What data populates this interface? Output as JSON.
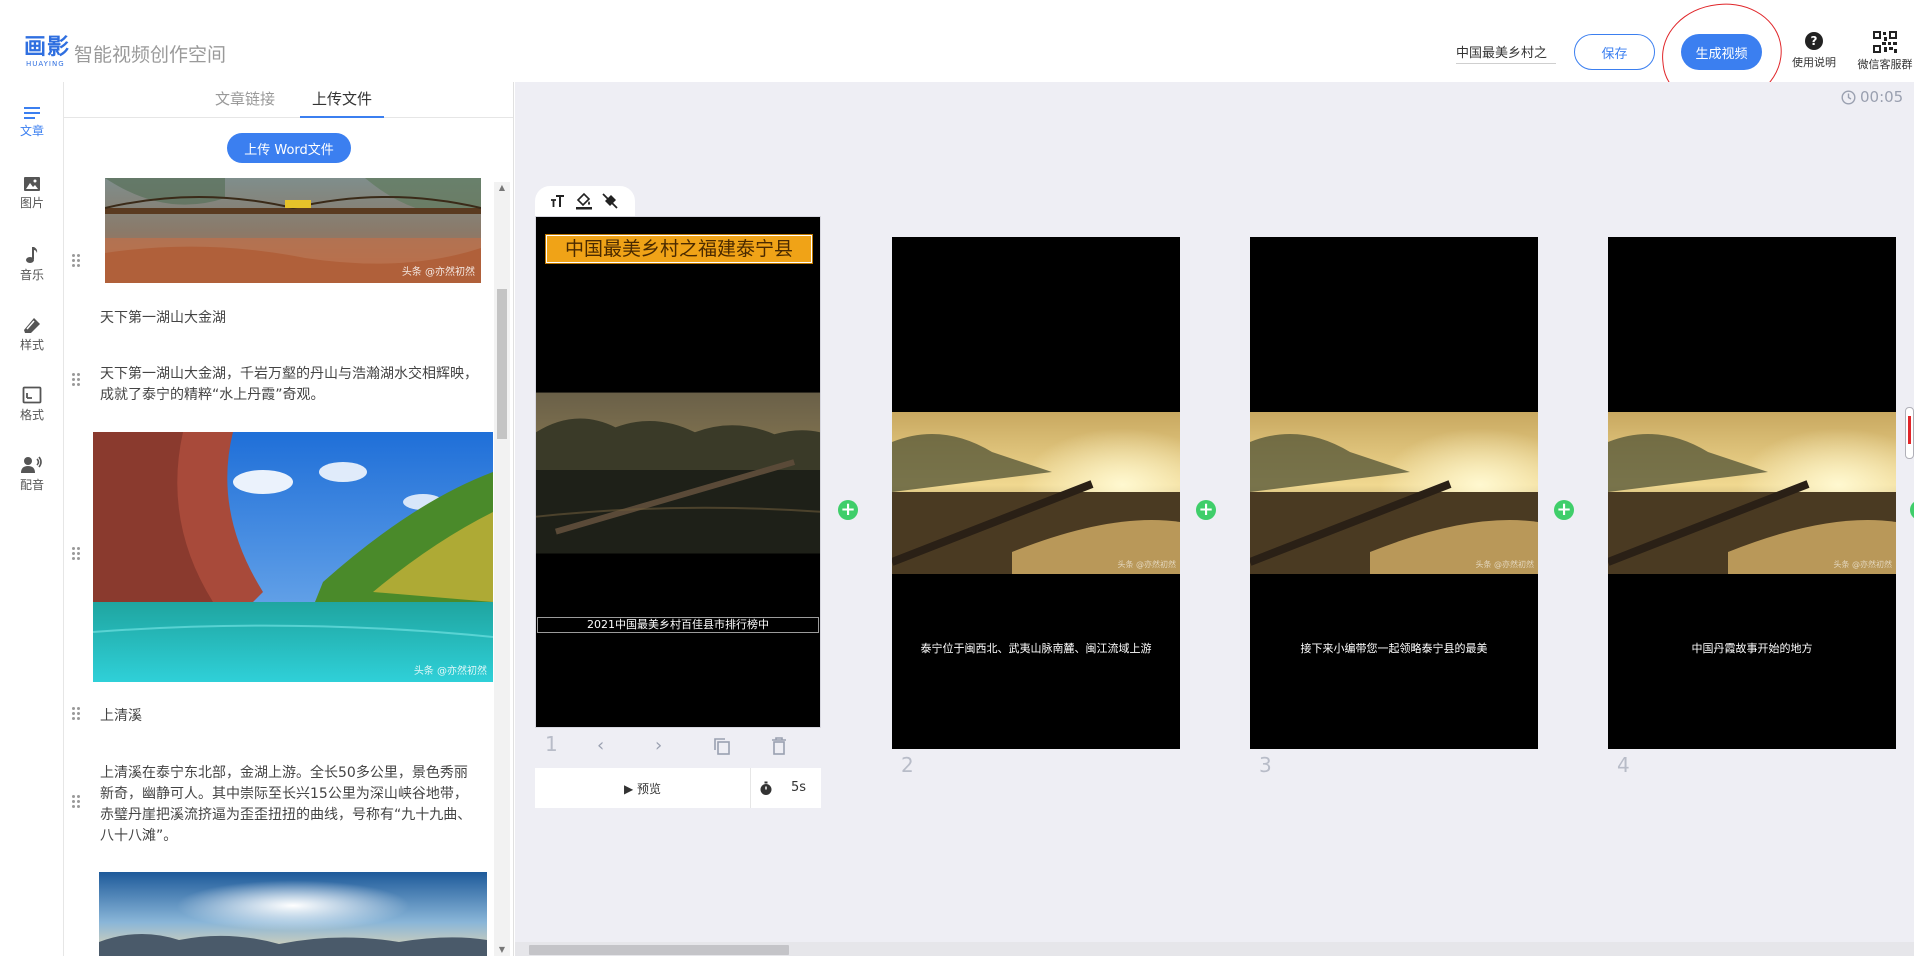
{
  "header": {
    "logo_cn": "画影",
    "logo_en": "HUAYING",
    "app_title": "智能视频创作空间",
    "title_value": "中国最美乡村之",
    "save_label": "保存",
    "generate_label": "生成视频",
    "help_label": "使用说明",
    "wechat_label": "微信客服群"
  },
  "sidebar": {
    "items": [
      {
        "label": "文章",
        "icon": "article-icon"
      },
      {
        "label": "图片",
        "icon": "image-icon"
      },
      {
        "label": "音乐",
        "icon": "music-icon"
      },
      {
        "label": "样式",
        "icon": "style-icon"
      },
      {
        "label": "格式",
        "icon": "format-icon"
      },
      {
        "label": "配音",
        "icon": "voice-icon"
      }
    ]
  },
  "panel": {
    "tabs": [
      "文章链接",
      "上传文件"
    ],
    "active_tab": "上传文件",
    "upload_button": "上传 Word文件",
    "watermark": "头条 @亦然初然",
    "paragraphs": [
      {
        "text": "天下第一湖山大金湖"
      },
      {
        "text": "天下第一湖山大金湖，千岩万壑的丹山与浩瀚湖水交相辉映，成就了泰宁的精粹“水上丹霞”奇观。"
      },
      {
        "text": "上清溪"
      },
      {
        "text": "上清溪在泰宁东北部，金湖上游。全长50多公里，景色秀丽新奇，幽静可人。其中崇际至长兴15公里为深山峡谷地带，赤璧丹崖把溪流挤逼为歪歪扭扭的曲线，号称有“九十九曲、八十八滩”。"
      }
    ]
  },
  "canvas": {
    "timer": "00:05",
    "preview_label": "预览",
    "duration": "5s",
    "frames": [
      {
        "number": "1",
        "title": "中国最美乡村之福建泰宁县",
        "caption": "2021中国最美乡村百佳县市排行榜中"
      },
      {
        "number": "2",
        "caption": "泰宁位于闽西北、武夷山脉南麓、闽江流域上游"
      },
      {
        "number": "3",
        "caption": "接下来小编带您一起领略泰宁县的最美"
      },
      {
        "number": "4",
        "caption": "中国丹霞故事开始的地方"
      }
    ],
    "frame_watermark": "头条 @亦然初然"
  },
  "colors": {
    "accent": "#3b7ff0",
    "annotation": "#e0262a",
    "add": "#3fce6a",
    "title_bg": "#f0a317"
  }
}
